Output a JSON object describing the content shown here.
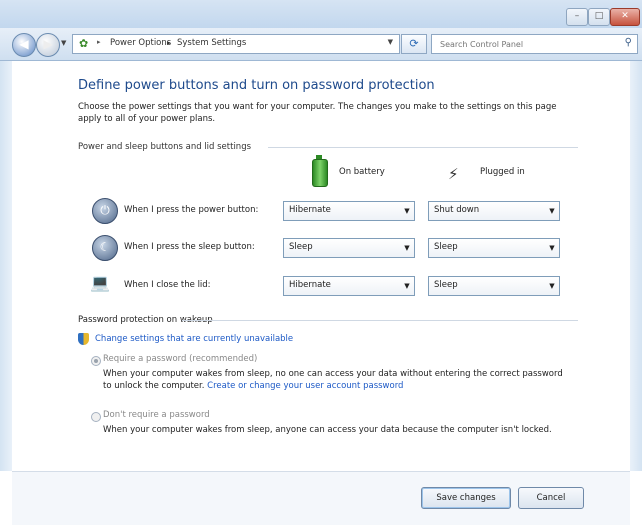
{
  "window": {
    "caption": {
      "minimize": "–",
      "maximize": "□",
      "close": "✕"
    }
  },
  "nav": {
    "breadcrumb": [
      "Power Options",
      "System Settings"
    ],
    "breadcrumb_separator": "▸",
    "search_placeholder": "Search Control Panel",
    "icons": {
      "back": "back-arrow-icon",
      "forward": "forward-arrow-icon",
      "refresh": "refresh-icon",
      "search": "magnifier-icon"
    }
  },
  "page": {
    "title": "Define power buttons and turn on password protection",
    "description": "Choose the power settings that you want for your computer. The changes you make to the settings on this page apply to all of your power plans.",
    "section_title": "Power and sleep buttons and lid settings",
    "columns": {
      "battery": "On battery",
      "plugged": "Plugged in"
    },
    "rows": [
      {
        "label": "When I press the power button:",
        "battery": "Hibernate",
        "plugged": "Shut down"
      },
      {
        "label": "When I press the sleep button:",
        "battery": "Sleep",
        "plugged": "Sleep"
      },
      {
        "label": "When I close the lid:",
        "battery": "Hibernate",
        "plugged": "Sleep"
      }
    ]
  },
  "password": {
    "title": "Password protection on wakeup",
    "change_link": "Change settings that are currently unavailable",
    "options": [
      {
        "label": "Require a password (recommended)",
        "selected": true,
        "description": "When your computer wakes from sleep, no one can access your data without entering the correct password to unlock the computer.",
        "link": "Create or change your user account password"
      },
      {
        "label": "Don't require a password",
        "selected": false,
        "description": "When your computer wakes from sleep, anyone can access your data because the computer isn't locked."
      }
    ]
  },
  "footer": {
    "save": "Save changes",
    "cancel": "Cancel"
  },
  "colors": {
    "title_blue": "#1e4a8c",
    "link_blue": "#1c59c6",
    "chrome_blue": "#cfdff0"
  }
}
